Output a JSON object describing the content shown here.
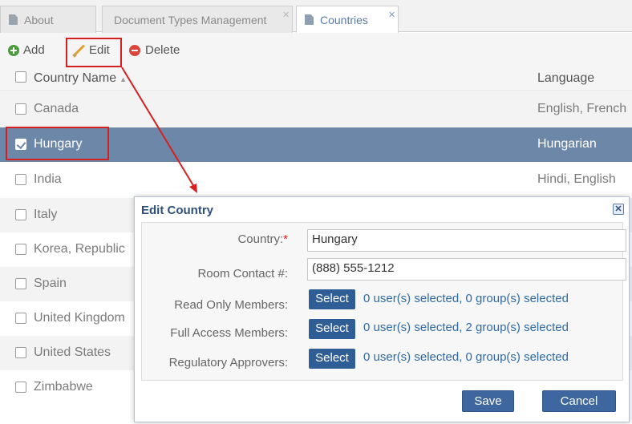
{
  "tabs": [
    {
      "label": "About",
      "active": false,
      "closable": false
    },
    {
      "label": "Document Types Management",
      "active": false,
      "closable": true
    },
    {
      "label": "Countries",
      "active": true,
      "closable": true
    }
  ],
  "toolbar": {
    "add_label": "Add",
    "edit_label": "Edit",
    "delete_label": "Delete"
  },
  "grid": {
    "columns": {
      "name": "Country Name",
      "language": "Language"
    },
    "rows": [
      {
        "name": "Canada",
        "language": "English, French",
        "selected": false
      },
      {
        "name": "Hungary",
        "language": "Hungarian",
        "selected": true
      },
      {
        "name": "India",
        "language": "Hindi, English",
        "selected": false
      },
      {
        "name": "Italy",
        "language": "",
        "selected": false
      },
      {
        "name": "Korea, Republic",
        "language": "",
        "selected": false
      },
      {
        "name": "Spain",
        "language": "",
        "selected": false
      },
      {
        "name": "United Kingdom",
        "language": "",
        "selected": false
      },
      {
        "name": "United States",
        "language": "",
        "selected": false
      },
      {
        "name": "Zimbabwe",
        "language": "",
        "selected": false
      }
    ]
  },
  "dialog": {
    "title": "Edit Country",
    "close_glyph": "✕",
    "country_label": "Country:",
    "required_mark": "*",
    "country_value": "Hungary",
    "room_contact_label": "Room Contact #:",
    "room_contact_value": "(888) 555-1212",
    "read_only_label": "Read Only Members:",
    "read_only_info": "0 user(s) selected, 0 group(s) selected",
    "full_access_label": "Full Access Members:",
    "full_access_info": "0 user(s) selected, 2 group(s) selected",
    "regulatory_label": "Regulatory Approvers:",
    "regulatory_info": "0 user(s) selected, 0 group(s) selected",
    "select_label": "Select",
    "save_label": "Save",
    "cancel_label": "Cancel"
  },
  "colors": {
    "selected_row": "#6d87a8",
    "highlight": "#d62020",
    "primary_button": "#3e67a0",
    "link_text": "#2f6aa8"
  }
}
